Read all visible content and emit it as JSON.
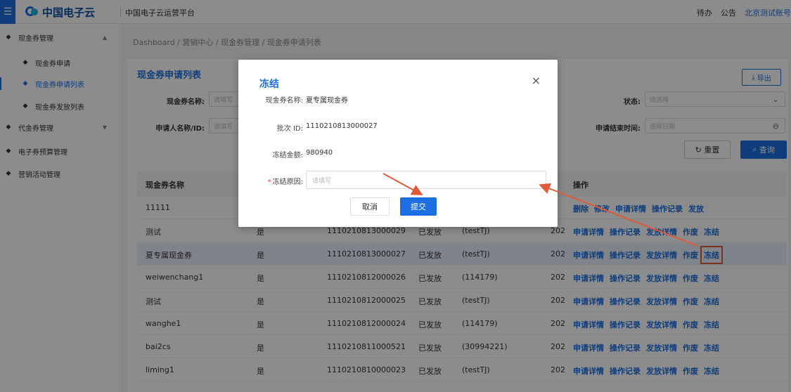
{
  "topbar": {
    "logo_text": "中国电子云",
    "platform_title": "中国电子云运营平台",
    "todo": "待办",
    "notice": "公告",
    "account": "北京测试账号"
  },
  "sidebar": {
    "items": [
      {
        "label": "现金券管理",
        "arrow": "▲"
      },
      {
        "label": "现金券申请"
      },
      {
        "label": "现金券申请列表"
      },
      {
        "label": "现金券发放列表"
      },
      {
        "label": "代金券管理",
        "arrow": "▼"
      },
      {
        "label": "电子券预算管理"
      },
      {
        "label": "营销活动管理"
      }
    ]
  },
  "breadcrumb": "Dashboard / 营销中心 / 现金券管理 / 现金券申请列表",
  "panel": {
    "title": "现金券申请列表",
    "export_label": "导出"
  },
  "filters": {
    "name_label": "现金券名称:",
    "name_placeholder": "请填写",
    "applicant_label": "申请人名称/ID:",
    "applicant_placeholder": "请填写",
    "status_label": "状态:",
    "status_placeholder": "请选择",
    "end_time_label": "申请结束时间:",
    "end_time_placeholder": "选择日期",
    "reset_label": "重置",
    "query_label": "查询"
  },
  "table": {
    "headers": [
      "现金券名称",
      "操作"
    ],
    "rows": [
      {
        "name": "11111",
        "flag": "",
        "batch": "",
        "status": "",
        "applicant": "",
        "date": "",
        "ops": [
          "删除",
          "修改",
          "申请详情",
          "操作记录",
          "发放"
        ]
      },
      {
        "name": "测试",
        "flag": "是",
        "batch": "1110210813000029",
        "status": "已发放",
        "applicant": "(testTJ)",
        "date": "202",
        "ops": [
          "申请详情",
          "操作记录",
          "发放详情",
          "作废",
          "冻结"
        ]
      },
      {
        "name": "夏专属现金券",
        "flag": "是",
        "batch": "1110210813000027",
        "status": "已发放",
        "applicant": "(testTJ)",
        "date": "202",
        "ops": [
          "申请详情",
          "操作记录",
          "发放详情",
          "作废",
          "冻结"
        ]
      },
      {
        "name": "weiwenchang1",
        "flag": "是",
        "batch": "1110210812000026",
        "status": "已发放",
        "applicant": "(114179)",
        "date": "202",
        "ops": [
          "申请详情",
          "操作记录",
          "发放详情",
          "作废",
          "冻结"
        ]
      },
      {
        "name": "测试",
        "flag": "是",
        "batch": "1110210812000025",
        "status": "已发放",
        "applicant": "(testTJ)",
        "date": "202",
        "ops": [
          "申请详情",
          "操作记录",
          "发放详情",
          "作废",
          "冻结"
        ]
      },
      {
        "name": "wanghe1",
        "flag": "是",
        "batch": "1110210812000024",
        "status": "已发放",
        "applicant": "(114179)",
        "date": "202",
        "ops": [
          "申请详情",
          "操作记录",
          "发放详情",
          "作废",
          "冻结"
        ]
      },
      {
        "name": "bai2cs",
        "flag": "是",
        "batch": "1110210811000521",
        "status": "已发放",
        "applicant": "(30994221)",
        "date": "202",
        "ops": [
          "申请详情",
          "操作记录",
          "发放详情",
          "作废",
          "冻结"
        ]
      },
      {
        "name": "liming1",
        "flag": "是",
        "batch": "1110210810000023",
        "status": "已发放",
        "applicant": "(testTJ)",
        "date": "202",
        "ops": [
          "申请详情",
          "操作记录",
          "发放详情",
          "作废",
          "冻结"
        ]
      }
    ]
  },
  "modal": {
    "title": "冻结",
    "close": "×",
    "coupon_name_label": "现金券名称:",
    "coupon_name_value": "夏专属现金券",
    "batch_label": "批次 ID:",
    "batch_value": "1110210813000027",
    "amount_label": "冻结金额:",
    "amount_value": "980940",
    "reason_label": "冻结原因:",
    "reason_required": "*",
    "reason_placeholder": "请填写",
    "cancel_label": "取消",
    "submit_label": "提交"
  },
  "colors": {
    "primary": "#1c6fe0",
    "annotation": "#e05a3a"
  }
}
